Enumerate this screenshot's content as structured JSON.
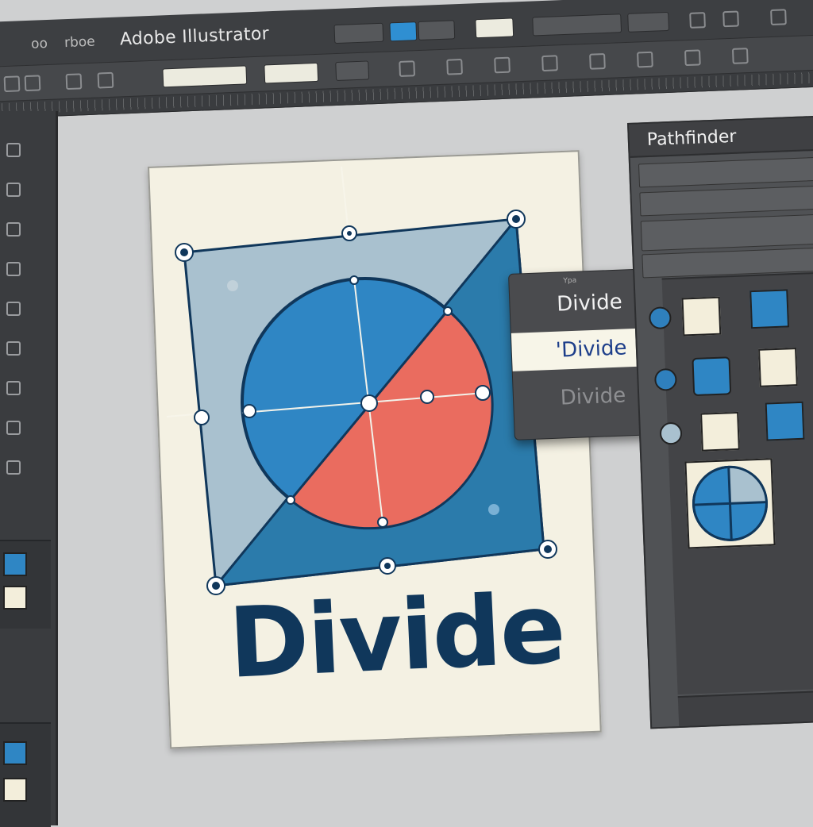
{
  "app": {
    "title": "Adobe Illustrator",
    "menu_words": [
      "oo",
      "rboe"
    ]
  },
  "panel": {
    "title": "Pathfinder"
  },
  "context_menu": {
    "tiny_label": "Ypa",
    "items": [
      {
        "label": "Divide",
        "state": "normal"
      },
      {
        "label": "'Divide",
        "state": "selected"
      },
      {
        "label": "Divide",
        "state": "disabled"
      }
    ]
  },
  "artboard": {
    "heading": "Divide"
  },
  "colors": {
    "square_light": "#a9c1cf",
    "square_dark": "#2b7bab",
    "circle_blue": "#2f86c4",
    "circle_red": "#ea6c5f",
    "outline": "#10375b",
    "text": "#10375b",
    "selected_text": "#1d3e8a"
  },
  "icons": {
    "menu_items": [
      "divide-icon"
    ]
  }
}
